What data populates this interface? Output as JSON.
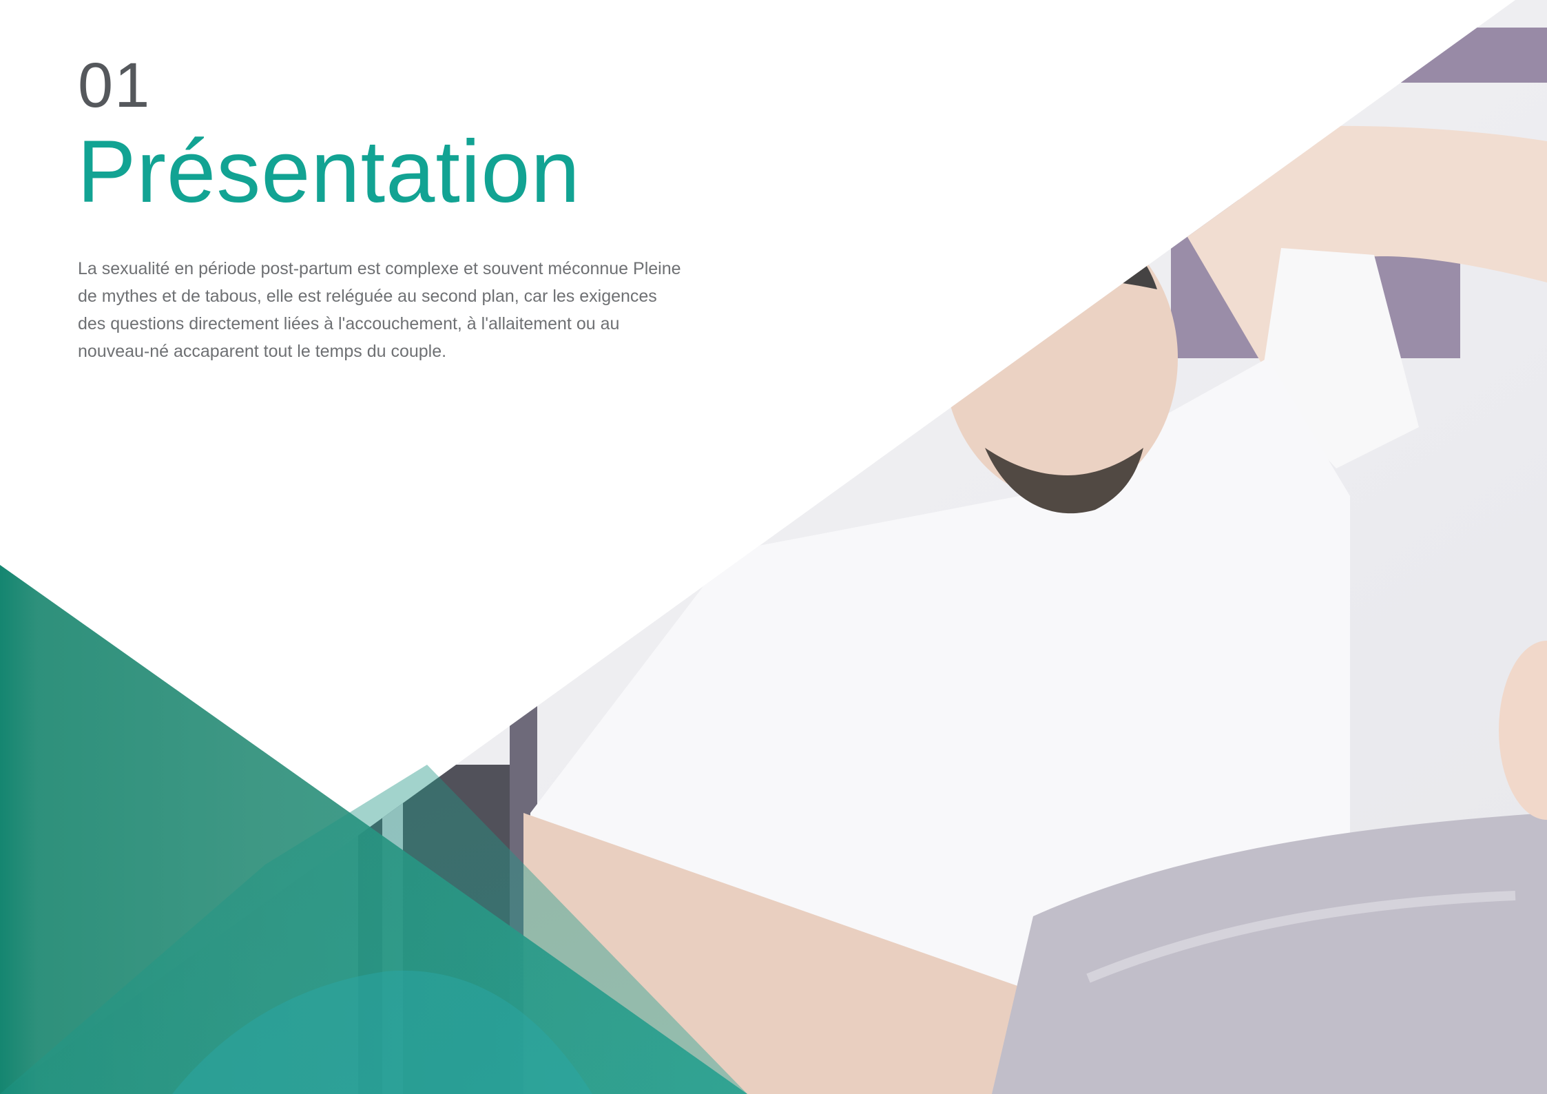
{
  "section": {
    "number": "01",
    "title": "Présentation"
  },
  "intro": {
    "paragraph": "La sexualité en période post-partum est complexe et souvent méconnue Pleine de mythes et de tabous, elle est reléguée au second plan, car les exigences des questions directement liées à l'accouchement, à l'allaitement ou au nouveau-né accaparent tout le temps du couple."
  },
  "colors": {
    "accent": "#12a393",
    "dark_green": "#007b64",
    "number_gray": "#55585c",
    "body_gray": "#6e7073"
  }
}
